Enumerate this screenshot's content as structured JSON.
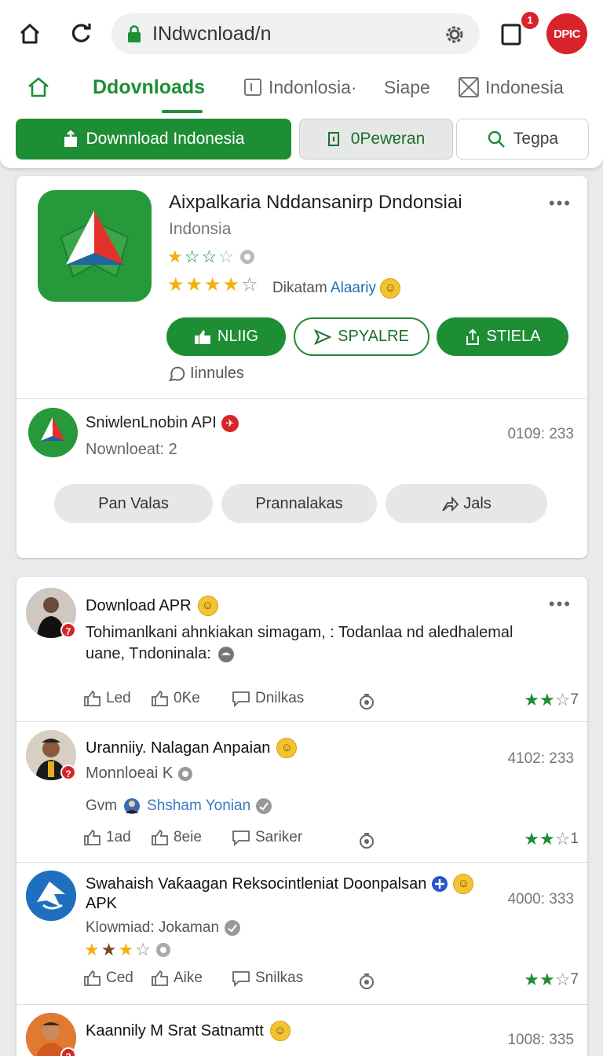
{
  "browser": {
    "url": "INdwcnload/n",
    "tabs_badge": "1",
    "profile_label": "DPIC"
  },
  "nav_tabs": [
    {
      "label": "Ddovnloads"
    },
    {
      "label": "Indonlosia·"
    },
    {
      "label": "Siape"
    },
    {
      "label": "Indonesia"
    }
  ],
  "action_buttons": {
    "download": "Downnload Indonesia",
    "preview": "0Pewɐran",
    "search": "Tegpa"
  },
  "app": {
    "title": "Aixpalkaria Nddansanirp Dndonsiai",
    "subtitle": "Indonsia",
    "rating_text": "Dikatam",
    "rating_link": "Alaariy",
    "buttons": [
      "NLIIG",
      "SPYALRE",
      "STIELA"
    ],
    "comments": "Iinnules"
  },
  "related": {
    "title": "SniwlenLnobin API",
    "meta": "Nownloeat: 2",
    "count": "0109: 233",
    "chips": [
      "Pan Valas",
      "Prannalakas",
      "Jals"
    ]
  },
  "posts": [
    {
      "name": "Download APR",
      "badge": "7",
      "text_line1": "Tohimanlkani ahnkiakan simagam, : Todanlaa nd aledhalemal",
      "text_line2": "uane, Tndoninala:",
      "actions": [
        "Led",
        "0Ƙe",
        "Dnilkas"
      ],
      "stars_count": "7",
      "rating": 2
    },
    {
      "name": "Uranniiy. Nalagan Anpaian",
      "badge": "2",
      "meta": "Monnloeai K",
      "meta2_prefix": "Gvm",
      "meta2_link": "Shsham Yonian",
      "count": "4102: 233",
      "actions": [
        "1ad",
        "8eie",
        "Sariker"
      ],
      "stars_count": "1",
      "rating": 2
    },
    {
      "name_line1": "Swahaish Vaƙaagan Reksocintleniat Doonpalsan",
      "name_line2": "APK",
      "meta": "Klowmiad: Jokaman",
      "count": "4000: 333",
      "actions": [
        "Ced",
        "Aike",
        "Snilkas"
      ],
      "stars_count": "7",
      "rating": 2
    },
    {
      "name": "Kaannily M Srat Satnamtt",
      "count": "1008: 335"
    }
  ],
  "colors": {
    "brand_green": "#1e8e35",
    "badge_red": "#d8232a",
    "link_blue": "#1a6fb5",
    "star_yellow": "#f2b010"
  }
}
